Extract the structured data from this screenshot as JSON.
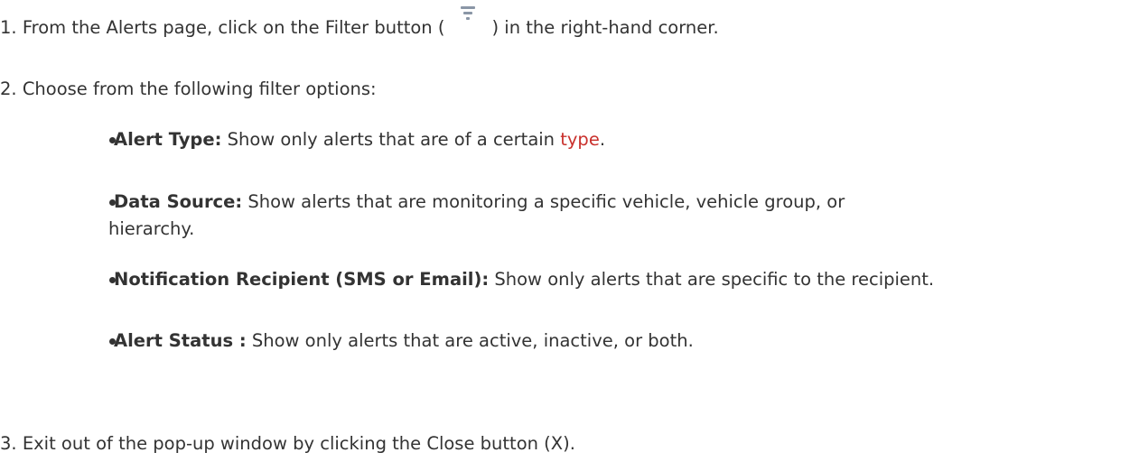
{
  "steps": [
    {
      "number": "1.",
      "text_before": "From the Alerts page, click on the Filter button (",
      "icon": "filter-icon",
      "text_after": ") in the right-hand corner."
    },
    {
      "number": "2.",
      "text": "Choose from the following filter options:"
    },
    {
      "number": "3.",
      "text": "Exit out of the pop-up window by clicking the Close button (X)."
    }
  ],
  "filter_options": [
    {
      "label": "Alert Type:",
      "text_before": " Show only alerts that are of a certain ",
      "link": "type",
      "text_after": "."
    },
    {
      "label": "Data Source:",
      "text_line1": " Show alerts that are monitoring a specific vehicle, vehicle group, or",
      "text_line2": "hierarchy."
    },
    {
      "label": "Notification Recipient (SMS or Email):",
      "text": " Show only alerts that are specific to the recipient."
    },
    {
      "label": "Alert Status :",
      "text": " Show only alerts that are active, inactive, or both."
    }
  ],
  "colors": {
    "text": "#333333",
    "link": "#c9302c",
    "icon": "#8a96a6"
  }
}
